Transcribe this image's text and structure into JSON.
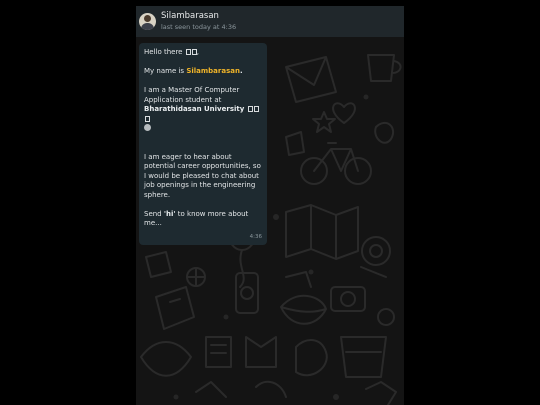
{
  "header": {
    "contact_name": "Silambarasan",
    "last_seen": "last seen today at 4:36"
  },
  "message": {
    "greeting": "Hello there",
    "name_intro": "My name is ",
    "name": "Silambarasan",
    "name_end": ".",
    "student_line": "I am a Master Of Computer Application student at",
    "university": "Bharathidasan University",
    "career_text": "I am eager to hear about potential career opportunities, so I would be pleased to chat about job openings in the engineering sphere.",
    "send_prefix": "Send ",
    "send_keyword": "'hi'",
    "send_suffix": " to know more about me...",
    "time": "4:36"
  },
  "colors": {
    "header_bg": "#20272b",
    "bubble_bg": "#1e2a30",
    "highlight": "#f0b429",
    "wallpaper_bg": "#141414"
  }
}
